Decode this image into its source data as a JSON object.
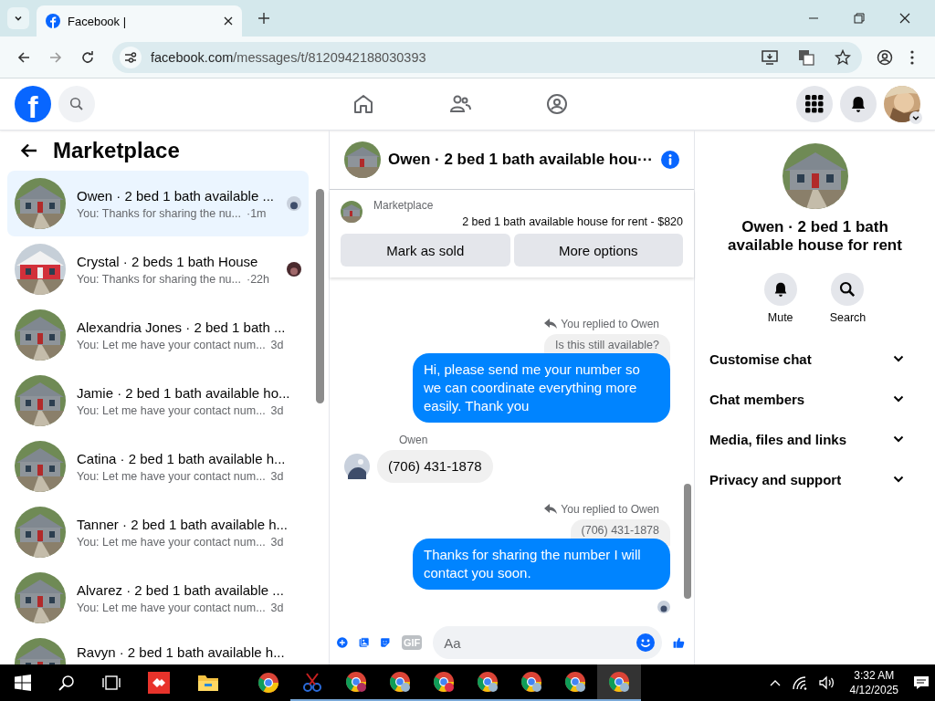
{
  "browser": {
    "tab_title": "Facebook |",
    "url_host": "facebook.com",
    "url_path": "/messages/t/8120942188030393"
  },
  "header": {
    "logo": "f"
  },
  "sidebar": {
    "title": "Marketplace",
    "conversations": [
      {
        "name": "Owen · 2 bed 1 bath available ...",
        "preview": "You: Thanks for sharing the nu...",
        "time": "·1m",
        "selected": true,
        "seen": true
      },
      {
        "name": "Crystal · 2 beds 1 bath House",
        "preview": "You: Thanks for sharing the nu...",
        "time": "·22h",
        "selected": false,
        "seen": true
      },
      {
        "name": "Alexandria Jones · 2 bed 1 bath ...",
        "preview": "You: Let me have your contact num...",
        "time": "3d",
        "selected": false,
        "seen": false
      },
      {
        "name": "Jamie · 2 bed 1 bath available ho...",
        "preview": "You: Let me have your contact num...",
        "time": "3d",
        "selected": false,
        "seen": false
      },
      {
        "name": "Catina · 2 bed 1 bath available h...",
        "preview": "You: Let me have your contact num...",
        "time": "3d",
        "selected": false,
        "seen": false
      },
      {
        "name": "Tanner · 2 bed 1 bath available h...",
        "preview": "You: Let me have your contact num...",
        "time": "3d",
        "selected": false,
        "seen": false
      },
      {
        "name": "Alvarez · 2 bed 1 bath available ...",
        "preview": "You: Let me have your contact num...",
        "time": "3d",
        "selected": false,
        "seen": false
      },
      {
        "name": "Ravyn · 2 bed 1 bath available h...",
        "selected": false,
        "seen": false
      }
    ]
  },
  "chat": {
    "title": "Owen · 2 bed 1 bath available hou···",
    "listing": {
      "label": "Marketplace",
      "title": "2 bed 1 bath available house for rent - $820",
      "buttons": [
        "Mark as sold",
        "More options"
      ]
    },
    "messages": [
      {
        "kind": "reply",
        "note": "You replied to Owen",
        "quote": "Is this still available?",
        "text": "Hi, please send me your number so we can coordinate everything more easily. Thank you"
      },
      {
        "kind": "received",
        "sender": "Owen",
        "text": "(706) 431-1878"
      },
      {
        "kind": "reply",
        "note": "You replied to Owen",
        "quote": "(706) 431-1878",
        "text": "Thanks for sharing the number I will contact you soon."
      }
    ],
    "composer": {
      "gif": "GIF",
      "placeholder": "Aa"
    }
  },
  "info": {
    "title": "Owen · 2 bed 1 bath available house for rent",
    "actions": [
      {
        "kind": "bell",
        "label": "Mute"
      },
      {
        "kind": "search",
        "label": "Search"
      }
    ],
    "sections": [
      "Customise chat",
      "Chat members",
      "Media, files and links",
      "Privacy and support"
    ]
  },
  "taskbar": {
    "time": "3:32 AM",
    "date": "4/12/2025"
  }
}
